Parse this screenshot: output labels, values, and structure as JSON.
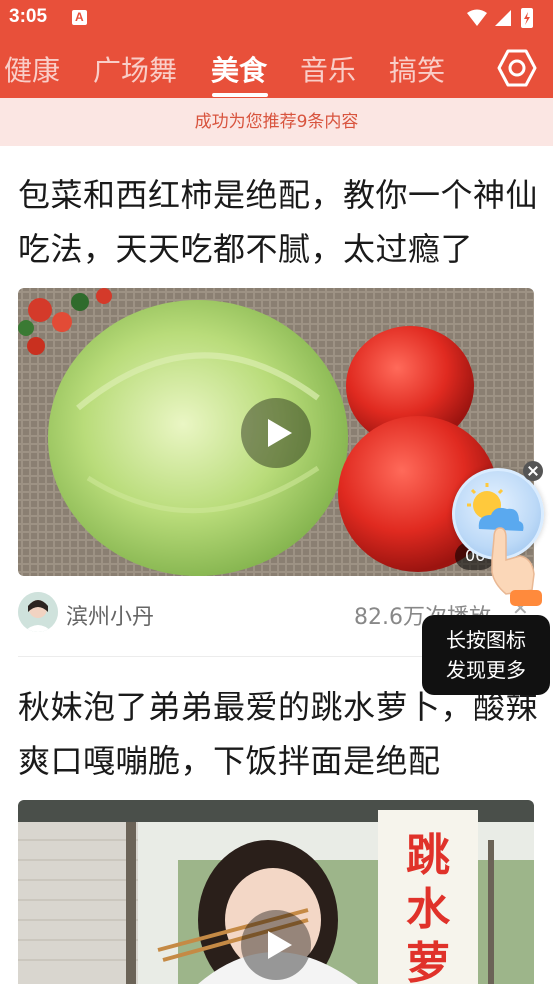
{
  "status": {
    "time": "3:05",
    "app_icon": "notification-app-icon"
  },
  "tabs": [
    {
      "label": "健康"
    },
    {
      "label": "广场舞"
    },
    {
      "label": "美食",
      "active": true
    },
    {
      "label": "音乐"
    },
    {
      "label": "搞笑"
    }
  ],
  "settings_icon": "settings-hexagon-icon",
  "banner": "成功为您推荐9条内容",
  "articles": [
    {
      "title": "包菜和西红柿是绝配，教你一个神仙吃法，天天吃都不腻，太过瘾了",
      "duration": "06",
      "author": "滨州小丹",
      "plays": "82.6万次播放"
    },
    {
      "title": "秋妹泡了弟弟最爱的跳水萝卜，酸辣爽口嘎嘣脆，下饭拌面是绝配",
      "overlay_text": "跳水萝"
    }
  ],
  "tooltip": {
    "line1": "长按图标",
    "line2": "发现更多"
  },
  "colors": {
    "accent": "#e8503a",
    "banner_bg": "#fbe6e3",
    "banner_text": "#d8543e"
  }
}
